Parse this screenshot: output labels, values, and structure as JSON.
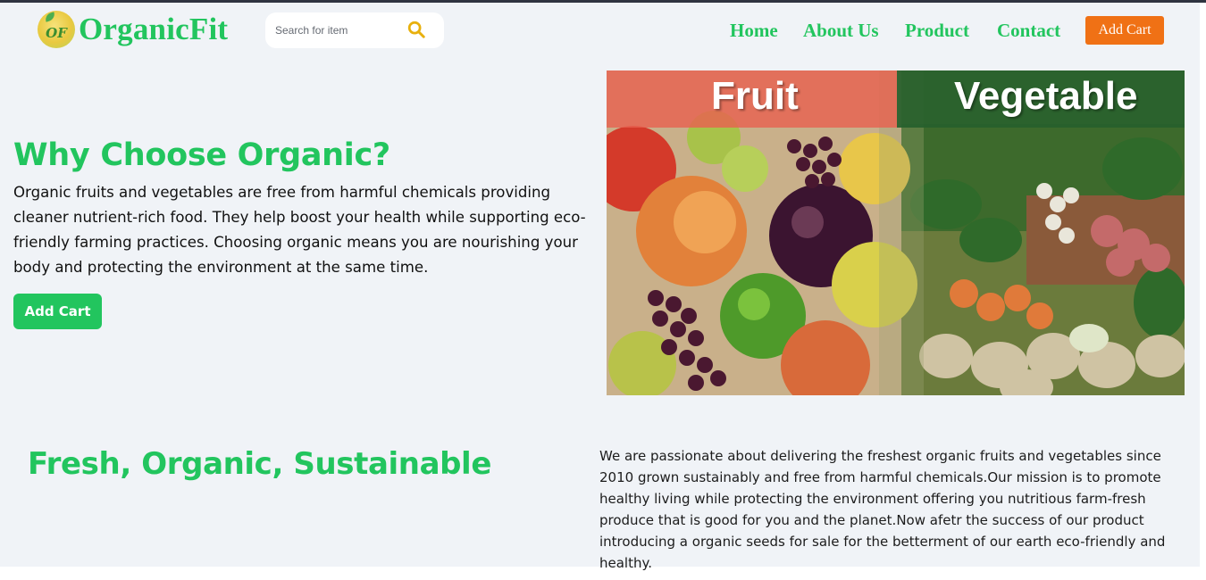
{
  "header": {
    "logo_initials": "OF",
    "logo_text": "OrganicFit",
    "search": {
      "placeholder": "Search for item",
      "value": ""
    },
    "nav": [
      {
        "label": "Home"
      },
      {
        "label": "About Us"
      },
      {
        "label": "Product"
      },
      {
        "label": "Contact"
      }
    ],
    "cart_label": "Add Cart",
    "colors": {
      "brand_green": "#22c55e",
      "cart_orange": "#f07115",
      "search_icon": "#e8b00c"
    },
    "icons": {
      "search": "search-icon",
      "logo": "leaf-logo-icon"
    }
  },
  "hero": {
    "title": "Why Choose Organic?",
    "body": "Organic fruits and vegetables are free from harmful chemicals providing cleaner nutrient-rich food. They help boost your health while supporting eco-friendly farming practices. Choosing organic means you are nourishing your body and protecting the environment at the same time.",
    "cart_label": "Add Cart",
    "image": {
      "fruit_label": "Fruit",
      "vegetable_label": "Vegetable"
    }
  },
  "about": {
    "title": "Fresh, Organic, Sustainable",
    "body": "We are passionate about delivering the freshest organic fruits and vegetables since 2010 grown sustainably and free from harmful chemicals.Our mission is to promote healthy living while protecting the environment offering you nutritious farm-fresh produce that is good for you and the planet.Now afetr the success of our product introducing a organic seeds for sale for the betterment of our earth eco-friendly and healthy."
  }
}
